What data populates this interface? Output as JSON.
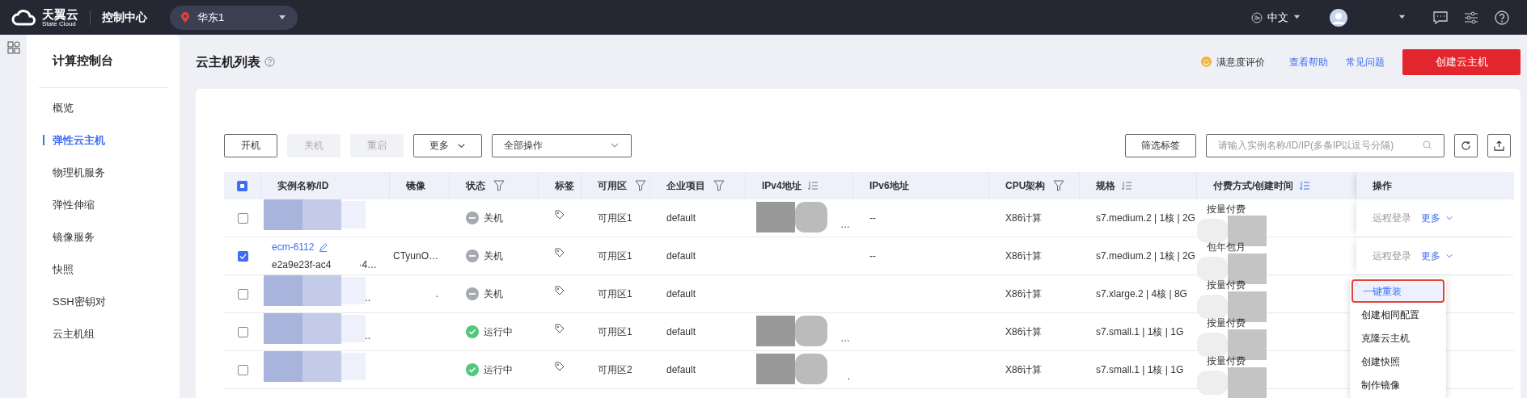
{
  "topbar": {
    "logo": {
      "name": "天翼云",
      "sub": "State Cloud"
    },
    "console": "控制中心",
    "region": "华东1",
    "language": "中文"
  },
  "sidebar": {
    "title": "计算控制台",
    "items": [
      {
        "label": "概览",
        "selected": false
      },
      {
        "label": "弹性云主机",
        "selected": true
      },
      {
        "label": "物理机服务",
        "selected": false
      },
      {
        "label": "弹性伸缩",
        "selected": false
      },
      {
        "label": "镜像服务",
        "selected": false
      },
      {
        "label": "快照",
        "selected": false
      },
      {
        "label": "SSH密钥对",
        "selected": false
      },
      {
        "label": "云主机组",
        "selected": false
      }
    ]
  },
  "page": {
    "title": "云主机列表",
    "links": [
      {
        "label": "满意度评价",
        "kind": "rating"
      },
      {
        "label": "查看帮助",
        "kind": "link"
      },
      {
        "label": "常见问题",
        "kind": "link"
      }
    ],
    "primary_button": "创建云主机"
  },
  "toolbar": {
    "buttons": [
      {
        "label": "开机",
        "disabled": false
      },
      {
        "label": "关机",
        "disabled": true
      },
      {
        "label": "重启",
        "disabled": true
      }
    ],
    "more": "更多",
    "operations_select": "全部操作",
    "tag_filter": "筛选标签",
    "search": {
      "placeholder": "请输入实例名称/ID/IP(多条IP以逗号分隔)"
    }
  },
  "table": {
    "select_all_partial": true,
    "columns": [
      {
        "label": "实例名称/ID"
      },
      {
        "label": "镜像"
      },
      {
        "label": "状态",
        "filterable": true
      },
      {
        "label": "标签"
      },
      {
        "label": "可用区",
        "filterable": true
      },
      {
        "label": "企业项目",
        "filterable": true
      },
      {
        "label": "IPv4地址",
        "sortable": true,
        "sort_active": false
      },
      {
        "label": "IPv6地址"
      },
      {
        "label": "CPU架构",
        "filterable": true
      },
      {
        "label": "规格",
        "sortable": true,
        "sort_active": false
      },
      {
        "label": "付费方式/创建时间",
        "sortable": true,
        "sort_active": true
      },
      {
        "label": "操作"
      }
    ],
    "rows": [
      {
        "checked": false,
        "name_redacted": true,
        "ipv4_redacted": true,
        "billing_redacted": true,
        "status": {
          "kind": "stopped",
          "label": "关机"
        },
        "zone": "可用区1",
        "project": "default",
        "ipv4_tail": "…",
        "ipv6": "--",
        "cpu": "X86计算",
        "spec": "s7.medium.2 | 1核 | 2G",
        "billing": "按量付费",
        "actions": [
          "远程登录",
          "更多"
        ]
      },
      {
        "checked": true,
        "billing_redacted": true,
        "name_link": "ecm-6112",
        "name_id": "e2a9e23f-ac4",
        "name_tail": "·4…",
        "image": "CTyunO…",
        "status": {
          "kind": "stopped",
          "label": "关机"
        },
        "zone": "可用区1",
        "project": "default",
        "ipv6": "--",
        "cpu": "X86计算",
        "spec": "s7.medium.2 | 1核 | 2G",
        "billing": "包年包月",
        "actions": [
          "远程登录",
          "更多"
        ]
      },
      {
        "checked": false,
        "name_redacted": true,
        "billing_redacted": true,
        "name_tail": "..",
        "image_tail": ".",
        "status": {
          "kind": "stopped",
          "label": "关机"
        },
        "zone": "可用区1",
        "project": "default",
        "cpu": "X86计算",
        "spec": "s7.xlarge.2 | 4核 | 8G",
        "billing": "按量付费"
      },
      {
        "checked": false,
        "name_redacted": true,
        "ipv4_redacted": true,
        "billing_redacted": true,
        "name_tail": "..",
        "status": {
          "kind": "running",
          "label": "运行中"
        },
        "zone": "可用区1",
        "project": "default",
        "ipv4_tail": "…",
        "cpu": "X86计算",
        "spec": "s7.small.1 | 1核 | 1G",
        "billing": "按量付费"
      },
      {
        "checked": false,
        "name_redacted": true,
        "ipv4_redacted": true,
        "billing_redacted": true,
        "status": {
          "kind": "running",
          "label": "运行中"
        },
        "zone": "可用区2",
        "project": "default",
        "ipv4_tail": ".",
        "cpu": "X86计算",
        "spec": "s7.small.1 | 1核 | 1G",
        "billing": "按量付费"
      }
    ]
  },
  "more_menu": {
    "items": [
      {
        "label": "一键重装",
        "selected": true
      },
      {
        "label": "创建相同配置",
        "selected": false
      },
      {
        "label": "克隆云主机",
        "selected": false
      },
      {
        "label": "创建快照",
        "selected": false
      },
      {
        "label": "制作镜像",
        "selected": false
      }
    ]
  }
}
